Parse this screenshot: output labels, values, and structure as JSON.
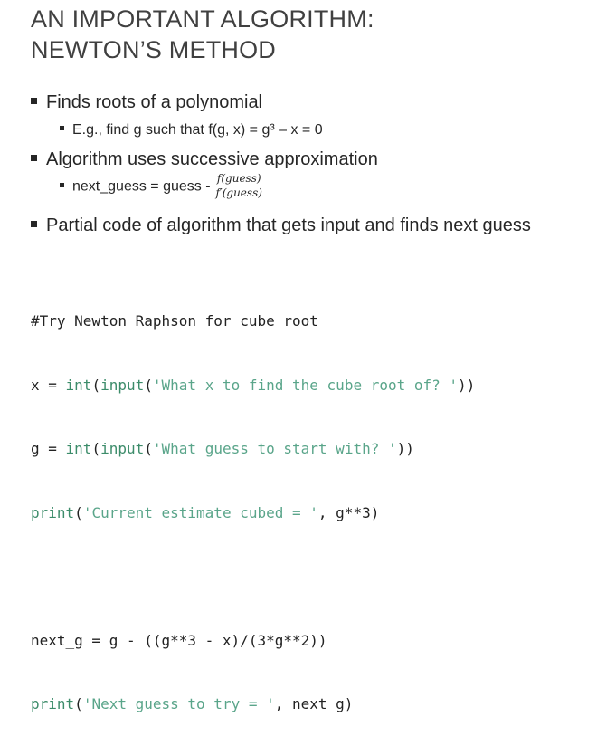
{
  "title": {
    "line1": "AN IMPORTANT ALGORITHM:",
    "line2": "NEWTON’S METHOD"
  },
  "bullets": {
    "b1": "Finds roots of a polynomial",
    "b1_sub": "E.g., find g such that f(g, x) = g³ – x = 0",
    "b2": "Algorithm uses successive approximation",
    "b2_sub_prefix": "next_guess = guess -",
    "b2_sub_num": "f(guess)",
    "b2_sub_den": "f′(guess)",
    "b3": "Partial code of algorithm that gets input and finds next guess"
  },
  "code": {
    "l1": "#Try Newton Raphson for cube root",
    "l2_a": "x = ",
    "l2_b": "int",
    "l2_c": "(",
    "l2_d": "input",
    "l2_e": "(",
    "l2_f": "'What x to find the cube root of? '",
    "l2_g": "))",
    "l3_a": "g = ",
    "l3_b": "int",
    "l3_c": "(",
    "l3_d": "input",
    "l3_e": "(",
    "l3_f": "'What guess to start with? '",
    "l3_g": "))",
    "l4_a": "print",
    "l4_b": "(",
    "l4_c": "'Current estimate cubed = '",
    "l4_d": ", g**3)",
    "l6": "next_g = g - ((g**3 - x)/(3*g**2))",
    "l7_a": "print",
    "l7_b": "(",
    "l7_c": "'Next guess to try = '",
    "l7_d": ", next_g)"
  }
}
